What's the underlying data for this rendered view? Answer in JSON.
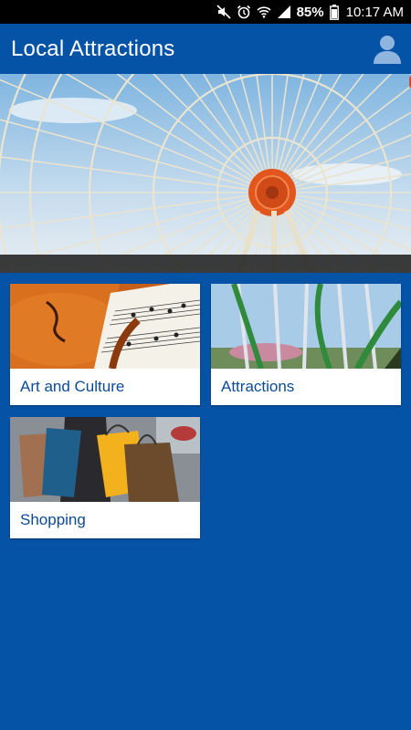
{
  "status_bar": {
    "battery_percent": "85%",
    "time": "10:17 AM",
    "icons": [
      "mute-icon",
      "alarm-icon",
      "wifi-icon",
      "signal-icon",
      "battery-icon"
    ]
  },
  "app_bar": {
    "title": "Local Attractions",
    "profile_icon": "person-icon"
  },
  "hero": {
    "image": "ferris-wheel"
  },
  "categories": [
    {
      "label": "Art and Culture",
      "image": "violin-sheet-music"
    },
    {
      "label": "Attractions",
      "image": "roller-coaster"
    },
    {
      "label": "Shopping",
      "image": "shopping-bags"
    }
  ],
  "colors": {
    "primary": "#0553a6",
    "tile_text": "#0b4a97",
    "tile_background": "#ffffff"
  }
}
